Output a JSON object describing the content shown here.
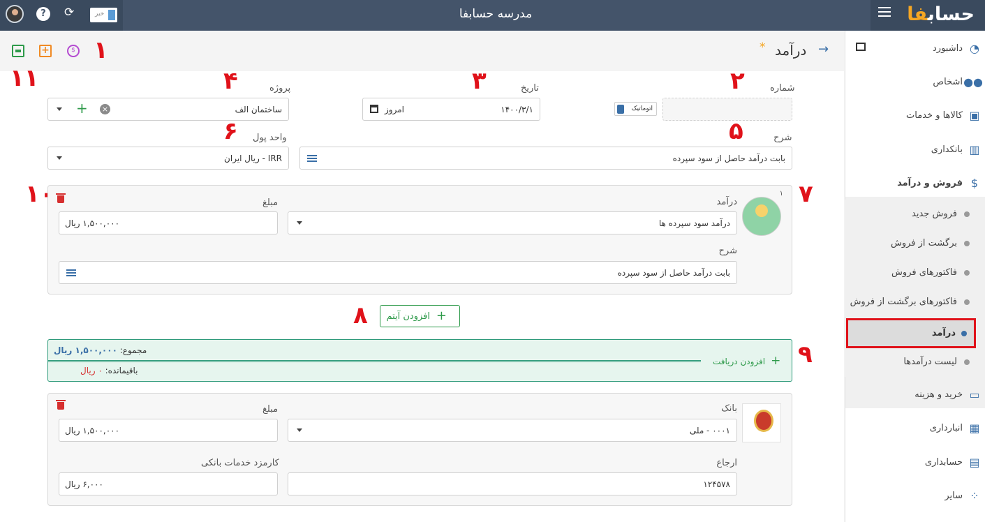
{
  "app": {
    "title": "مدرسه حسابفا",
    "logo_main": "حساب",
    "logo_accent": "فا",
    "toggle_label": "خیر"
  },
  "page": {
    "title": "درآمد",
    "star": "*"
  },
  "annotations": [
    "۱",
    "۲",
    "۳",
    "۴",
    "۵",
    "۶",
    "۷",
    "۸",
    "۹",
    "۱۰",
    "۱۱"
  ],
  "sidebar": {
    "items": [
      {
        "label": "داشبورد",
        "icon": "dashboard-icon"
      },
      {
        "label": "اشخاص",
        "icon": "people-icon"
      },
      {
        "label": "کالاها و خدمات",
        "icon": "box-icon"
      },
      {
        "label": "بانکداری",
        "icon": "bank-icon"
      },
      {
        "label": "فروش و درآمد",
        "icon": "sales-icon"
      },
      {
        "label": "خرید و هزینه",
        "icon": "wallet-icon"
      },
      {
        "label": "انبارداری",
        "icon": "warehouse-icon"
      },
      {
        "label": "حسابداری",
        "icon": "calculator-icon"
      },
      {
        "label": "سایر",
        "icon": "other-icon"
      }
    ],
    "sub_items": [
      {
        "label": "فروش جدید"
      },
      {
        "label": "برگشت از فروش"
      },
      {
        "label": "فاکتورهای فروش"
      },
      {
        "label": "فاکتورهای برگشت از فروش"
      },
      {
        "label": "درآمد"
      },
      {
        "label": "لیست درآمدها"
      }
    ]
  },
  "form": {
    "number_label": "شماره",
    "auto_label": "اتوماتیک",
    "date_label": "تاریخ",
    "date_value": "۱۴۰۰/۳/۱",
    "date_today": "امروز",
    "project_label": "پروژه",
    "project_value": "ساختمان الف",
    "desc_label": "شرح",
    "desc_value": "بابت درآمد حاصل از سود سپرده",
    "currency_label": "واحد پول",
    "currency_value": "IRR - ریال ایران"
  },
  "income_item": {
    "index": "۱",
    "income_label": "درآمد",
    "income_value": "درآمد سود سپرده ها",
    "amount_label": "مبلغ",
    "amount_value": "۱,۵۰۰,۰۰۰ ریال",
    "desc_label": "شرح",
    "desc_value": "بابت درآمد حاصل از سود سپرده"
  },
  "add_item_label": "افزودن آیتم",
  "payment_summary": {
    "total_label": "مجموع:",
    "total_value": "۱,۵۰۰,۰۰۰ ریال",
    "remaining_label": "باقیمانده:",
    "remaining_value": "۰ ریال",
    "add_payment_label": "افزودن دریافت"
  },
  "payment": {
    "bank_label": "بانک",
    "bank_value": "۰۰۰۱ - ملی",
    "amount_label": "مبلغ",
    "amount_value": "۱,۵۰۰,۰۰۰ ریال",
    "ref_label": "ارجاع",
    "ref_value": "۱۲۴۵۷۸",
    "fee_label": "کارمزد خدمات بانکی",
    "fee_value": "۶,۰۰۰ ریال"
  }
}
